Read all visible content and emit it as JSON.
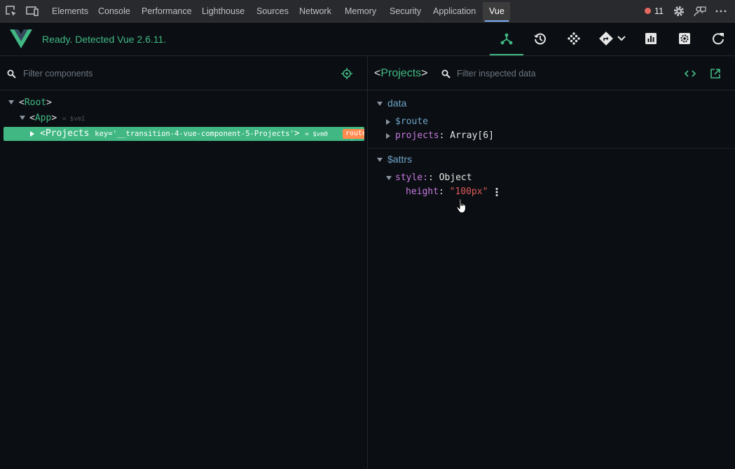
{
  "devtools": {
    "tabs": [
      "Elements",
      "Console",
      "Performance",
      "Lighthouse",
      "Sources",
      "Network",
      "Memory",
      "Security",
      "Application",
      "Vue"
    ],
    "active_tab": "Vue",
    "error_count": "11"
  },
  "vuebar": {
    "status": "Ready. Detected Vue 2.6.11."
  },
  "components": {
    "filter_placeholder": "Filter components",
    "root": {
      "name": "Root"
    },
    "app": {
      "name": "App",
      "ref": "= $vm1"
    },
    "projects": {
      "name": "Projects",
      "attr_key": "key=",
      "attr_value": "'__transition-4-vue-component-5-Projects'",
      "ref": "= $vm0",
      "badge": "router-view"
    }
  },
  "inspector": {
    "title": "Projects",
    "filter_placeholder": "Filter inspected data",
    "sections": [
      {
        "label": "data",
        "props": [
          {
            "key": "$route"
          },
          {
            "key": "projects",
            "value": "Array[6]"
          }
        ]
      },
      {
        "label": "$attrs",
        "props": [
          {
            "key": "style:",
            "value": ": Object"
          },
          {
            "key": "height",
            "value": "\"100px\""
          }
        ]
      }
    ]
  },
  "colors": {
    "vue_green": "#41b883",
    "badge_orange": "#ff8b4f",
    "string_red": "#e05a5a",
    "key_purple": "#c678dd"
  }
}
